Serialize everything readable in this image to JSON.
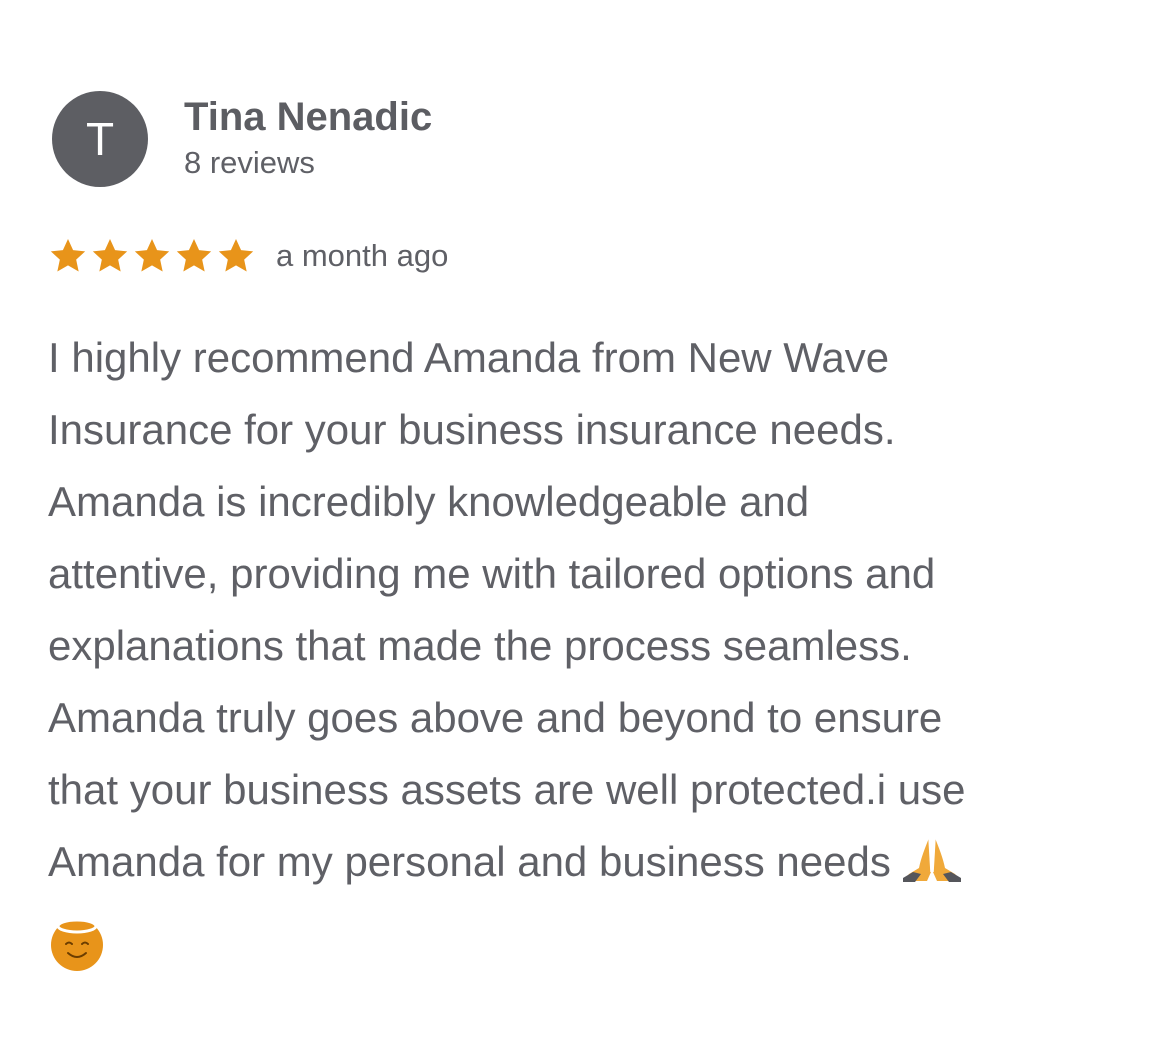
{
  "reviewer": {
    "initial": "T",
    "name": "Tina Nenadic",
    "reviews": "8 reviews"
  },
  "rating": {
    "stars": 5,
    "max": 5,
    "star_icon": "star-icon",
    "color": "#e8941a"
  },
  "date": "a month ago",
  "review": {
    "lines": [
      "I highly recommend Amanda from New Wave",
      "Insurance for your business insurance needs.",
      "Amanda is incredibly knowledgeable and",
      "attentive, providing me with tailored options and",
      "explanations that made the process seamless.",
      "Amanda truly goes above and beyond to ensure",
      "that your business assets are well protected.i use",
      "Amanda for my personal and business needs"
    ],
    "emojis": [
      "folded-hands-icon",
      "smiling-face-with-halo-icon"
    ]
  },
  "colors": {
    "text": "#5f6066",
    "avatar_bg": "#5d5e63",
    "star": "#e8941a"
  }
}
